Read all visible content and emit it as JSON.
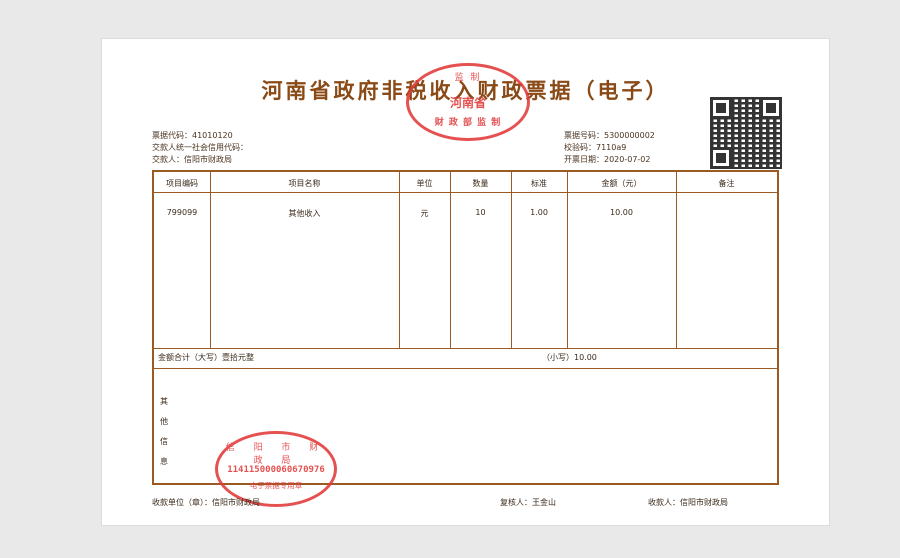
{
  "title": "河南省政府非税收入财政票据（电子）",
  "seal_top": {
    "arc": "监 制",
    "mid": "河南省",
    "bottom": "财 政 部 监 制"
  },
  "header_left": {
    "code": "票据代码：41010120",
    "payer_credit": "交款人统一社会信用代码：",
    "payer": "交款人：信阳市财政局"
  },
  "header_right": {
    "number": "票据号码：5300000002",
    "check_code": "校验码：7110a9",
    "issue_date": "开票日期：2020-07-02"
  },
  "table": {
    "headers": [
      "项目编码",
      "项目名称",
      "单位",
      "数量",
      "标准",
      "金额（元）",
      "备注"
    ],
    "row": [
      "799099",
      "其他收入",
      "元",
      "10",
      "1.00",
      "10.00",
      ""
    ]
  },
  "sum": {
    "upper": "金额合计（大写）壹拾元整",
    "lower": "（小写）10.00"
  },
  "other_info": [
    "其",
    "他",
    "信",
    "息"
  ],
  "seal_bottom": {
    "arc": "信 阳 市 财 政 局",
    "number": "114115000060670976",
    "bottom": "电子票据专用章"
  },
  "footer": {
    "payee_unit": "收款单位（章）：信阳市财政局",
    "reviewer": "复核人：王金山",
    "collector": "收款人：信阳市财政局"
  }
}
